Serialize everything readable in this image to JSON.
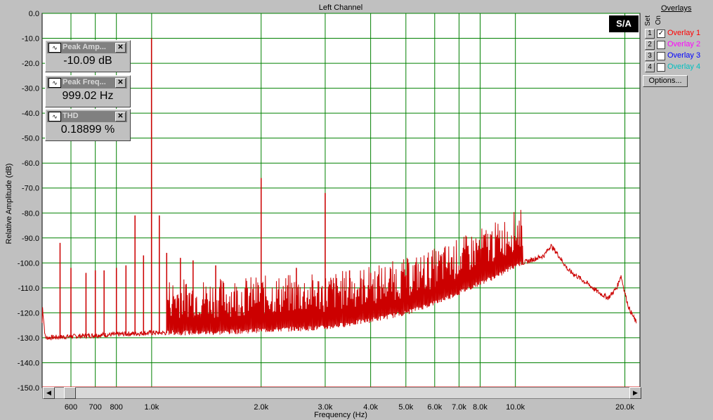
{
  "colors": {
    "plot_bg": "#ffffff",
    "grid": "#008000",
    "trace": "#cc0000",
    "marker_line": "#cc0000"
  },
  "chart_data": {
    "type": "line",
    "title": "Left Channel",
    "xlabel": "Frequency (Hz)",
    "ylabel": "Relative Amplitude (dB)",
    "x_scale": "log",
    "xlim": [
      500,
      22000
    ],
    "ylim": [
      -150,
      0
    ],
    "grid": true,
    "x_ticks": [
      "600",
      "700",
      "800",
      "1.0k",
      "2.0k",
      "3.0k",
      "4.0k",
      "5.0k",
      "6.0k",
      "7.0k",
      "8.0k",
      "10.0k",
      "20.0k"
    ],
    "y_ticks": [
      "0.0",
      "-10.0",
      "-20.0",
      "-30.0",
      "-40.0",
      "-50.0",
      "-60.0",
      "-70.0",
      "-80.0",
      "-90.0",
      "-100.0",
      "-110.0",
      "-120.0",
      "-130.0",
      "-140.0",
      "-150.0"
    ],
    "series": [
      {
        "name": "Overlay 1",
        "floor": [
          [
            500,
            -116
          ],
          [
            510,
            -130
          ],
          [
            700,
            -129
          ],
          [
            1000,
            -128
          ],
          [
            1500,
            -128
          ],
          [
            2000,
            -127
          ],
          [
            3000,
            -126
          ],
          [
            4000,
            -123
          ],
          [
            5000,
            -120
          ],
          [
            6000,
            -116
          ],
          [
            7000,
            -112
          ],
          [
            8000,
            -108
          ],
          [
            9000,
            -105
          ],
          [
            10000,
            -101
          ],
          [
            11000,
            -99
          ],
          [
            12000,
            -97
          ],
          [
            12500,
            -93
          ],
          [
            13000,
            -96
          ],
          [
            14000,
            -103
          ],
          [
            15000,
            -106
          ],
          [
            16000,
            -109
          ],
          [
            17000,
            -112
          ],
          [
            18000,
            -114
          ],
          [
            19000,
            -110
          ],
          [
            19500,
            -105
          ],
          [
            20000,
            -112
          ],
          [
            20500,
            -118
          ],
          [
            21500,
            -124
          ]
        ],
        "peaks": [
          [
            560,
            -92
          ],
          [
            600,
            -102
          ],
          [
            660,
            -104
          ],
          [
            700,
            -103
          ],
          [
            740,
            -103
          ],
          [
            800,
            -102
          ],
          [
            850,
            -101
          ],
          [
            900,
            -81
          ],
          [
            950,
            -97
          ],
          [
            999,
            -10
          ],
          [
            1050,
            -81
          ],
          [
            1100,
            -96
          ],
          [
            1200,
            -98
          ],
          [
            1300,
            -99
          ],
          [
            1500,
            -101
          ],
          [
            2000,
            -66
          ],
          [
            2500,
            -102
          ],
          [
            3000,
            -72
          ],
          [
            3500,
            -103
          ],
          [
            4000,
            -104
          ],
          [
            5000,
            -105
          ],
          [
            6000,
            -101
          ],
          [
            7000,
            -103
          ],
          [
            8000,
            -100
          ],
          [
            9000,
            -98
          ],
          [
            10000,
            -97
          ]
        ]
      }
    ]
  },
  "meters": [
    {
      "title": "Peak Amp...",
      "value": "-10.09 dB"
    },
    {
      "title": "Peak Freq...",
      "value": "999.02 Hz"
    },
    {
      "title": "THD",
      "value": "0.18899 %"
    }
  ],
  "overlays": {
    "header": "Overlays",
    "col_set": "Set",
    "col_on": "On",
    "items": [
      {
        "set": "1",
        "label": "Overlay 1",
        "checked": true,
        "color": "#ff0000"
      },
      {
        "set": "2",
        "label": "Overlay 2",
        "checked": false,
        "color": "#ff00ff"
      },
      {
        "set": "3",
        "label": "Overlay 3",
        "checked": false,
        "color": "#0000ff"
      },
      {
        "set": "4",
        "label": "Overlay 4",
        "checked": false,
        "color": "#00c0c0"
      }
    ],
    "options_label": "Options..."
  },
  "logo_text": "S/A"
}
